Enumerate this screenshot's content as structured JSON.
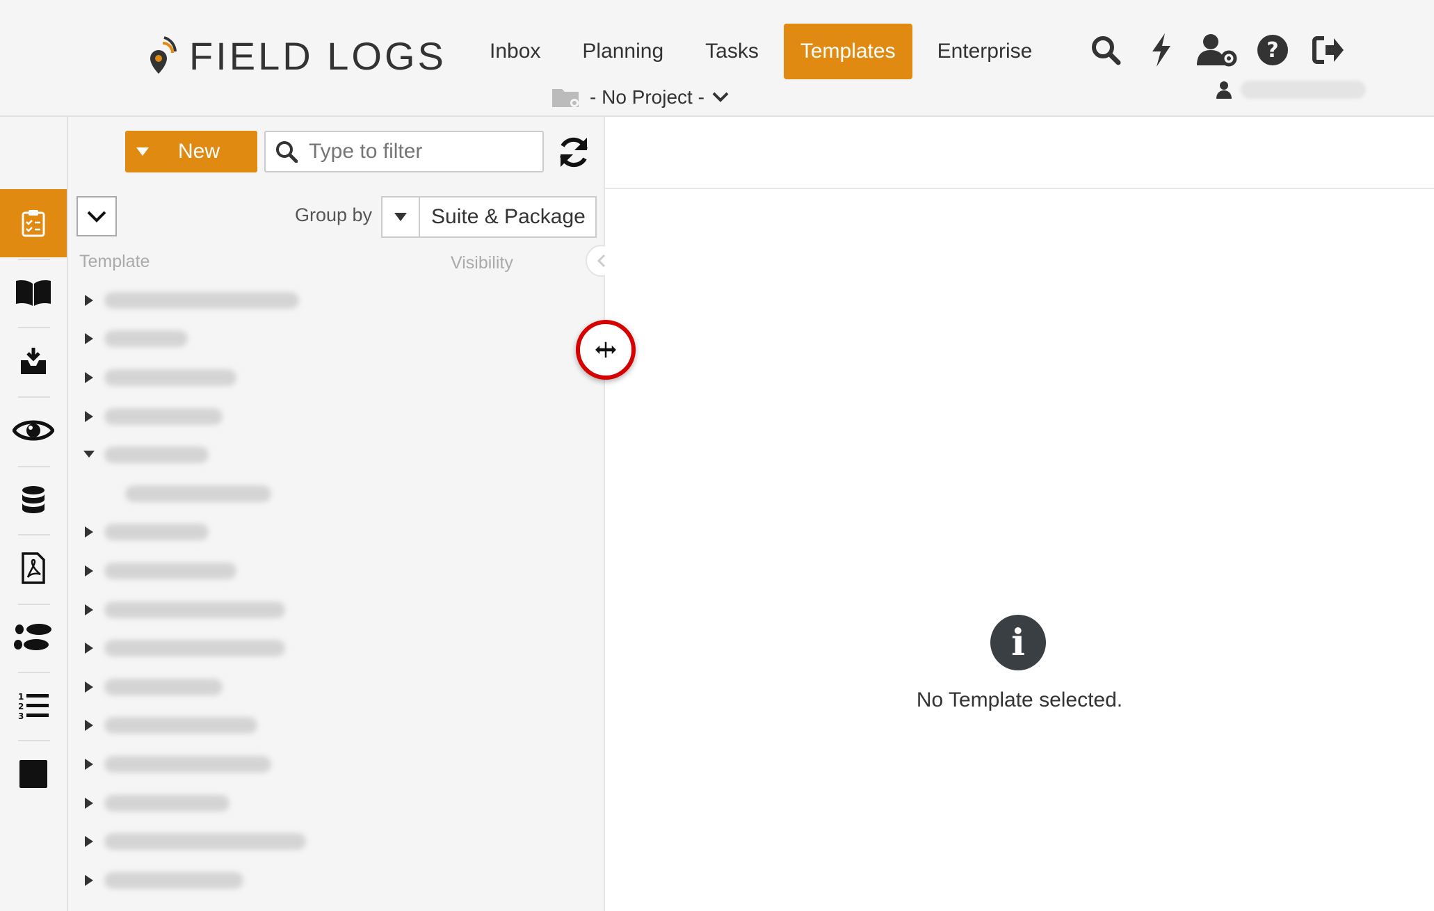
{
  "app": {
    "logo_text": "FIELD LOGS"
  },
  "nav": {
    "items": [
      {
        "label": "Inbox"
      },
      {
        "label": "Planning"
      },
      {
        "label": "Tasks"
      },
      {
        "label": "Templates",
        "active": true
      },
      {
        "label": "Enterprise"
      }
    ]
  },
  "top_icons": [
    "search-icon",
    "bolt-icon",
    "user-settings-icon",
    "help-icon",
    "sign-out-icon"
  ],
  "project": {
    "label": "- No Project -"
  },
  "sidebar": {
    "items": [
      {
        "icon": "clipboard-checklist-icon",
        "active": true
      },
      {
        "icon": "book-icon"
      },
      {
        "icon": "inbox-download-icon"
      },
      {
        "icon": "eye-icon"
      },
      {
        "icon": "database-icon"
      },
      {
        "icon": "pdf-file-icon"
      },
      {
        "icon": "footsteps-icon"
      },
      {
        "icon": "numbered-list-icon"
      },
      {
        "icon": "stop-square-icon"
      }
    ]
  },
  "toolbar": {
    "new_label": "New",
    "filter_placeholder": "Type to filter"
  },
  "grouping": {
    "label": "Group by",
    "value": "Suite & Package"
  },
  "table": {
    "columns": {
      "template": "Template",
      "visibility": "Visibility"
    }
  },
  "tree": {
    "rows": [
      {
        "expanded": false,
        "indent": 0,
        "w": 280
      },
      {
        "expanded": false,
        "indent": 0,
        "w": 120
      },
      {
        "expanded": false,
        "indent": 0,
        "w": 190
      },
      {
        "expanded": false,
        "indent": 0,
        "w": 170
      },
      {
        "expanded": true,
        "indent": 0,
        "w": 150
      },
      {
        "expanded": null,
        "indent": 1,
        "w": 210
      },
      {
        "expanded": false,
        "indent": 0,
        "w": 150
      },
      {
        "expanded": false,
        "indent": 0,
        "w": 190
      },
      {
        "expanded": false,
        "indent": 0,
        "w": 260
      },
      {
        "expanded": false,
        "indent": 0,
        "w": 260
      },
      {
        "expanded": false,
        "indent": 0,
        "w": 170
      },
      {
        "expanded": false,
        "indent": 0,
        "w": 220
      },
      {
        "expanded": false,
        "indent": 0,
        "w": 240
      },
      {
        "expanded": false,
        "indent": 0,
        "w": 180
      },
      {
        "expanded": false,
        "indent": 0,
        "w": 290
      },
      {
        "expanded": false,
        "indent": 0,
        "w": 200
      }
    ]
  },
  "detail": {
    "empty_message": "No Template selected."
  },
  "colors": {
    "accent": "#e08a12",
    "dark": "#333333"
  }
}
